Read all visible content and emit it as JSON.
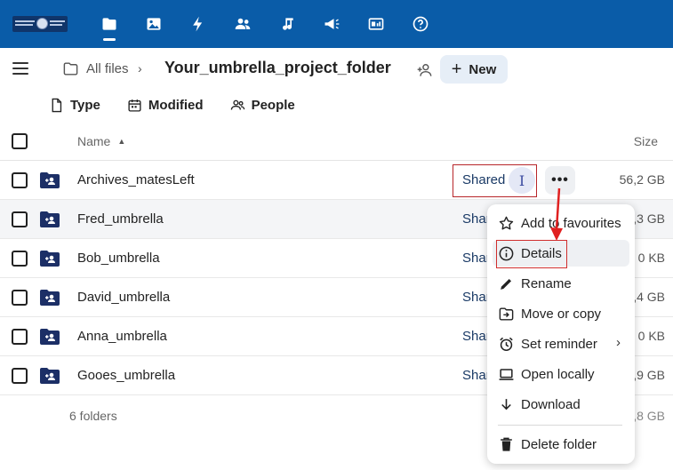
{
  "breadcrumb": {
    "all_files": "All files",
    "current_folder": "Your_umbrella_project_folder",
    "new_button": "New"
  },
  "filters": {
    "type": "Type",
    "modified": "Modified",
    "people": "People"
  },
  "table": {
    "header_name": "Name",
    "header_size": "Size",
    "rows": [
      {
        "name": "Archives_matesLeft",
        "shared": "Shared",
        "avatar": "I",
        "size": "56,2 GB"
      },
      {
        "name": "Fred_umbrella",
        "shared": "Shar",
        "size": ",3 GB"
      },
      {
        "name": "Bob_umbrella",
        "shared": "Shar",
        "size": "0 KB"
      },
      {
        "name": "David_umbrella",
        "shared": "Shar",
        "size": ",4 GB"
      },
      {
        "name": "Anna_umbrella",
        "shared": "Shar",
        "size": "0 KB"
      },
      {
        "name": "Gooes_umbrella",
        "shared": "Shar",
        "size": ",9 GB"
      }
    ],
    "footer_count": "6 folders",
    "footer_size": ",8 GB"
  },
  "menu": {
    "items": [
      {
        "label": "Add to favourites",
        "icon": "star-icon"
      },
      {
        "label": "Details",
        "icon": "info-icon"
      },
      {
        "label": "Rename",
        "icon": "pencil-icon"
      },
      {
        "label": "Move or copy",
        "icon": "move-icon"
      },
      {
        "label": "Set reminder",
        "icon": "alarm-icon"
      },
      {
        "label": "Open locally",
        "icon": "laptop-icon"
      },
      {
        "label": "Download",
        "icon": "download-icon"
      },
      {
        "label": "Delete folder",
        "icon": "trash-icon"
      }
    ]
  },
  "colors": {
    "header_bg": "#0a5ca8",
    "folder_icon": "#1c2f66",
    "annotation_red": "#d02e2e"
  }
}
